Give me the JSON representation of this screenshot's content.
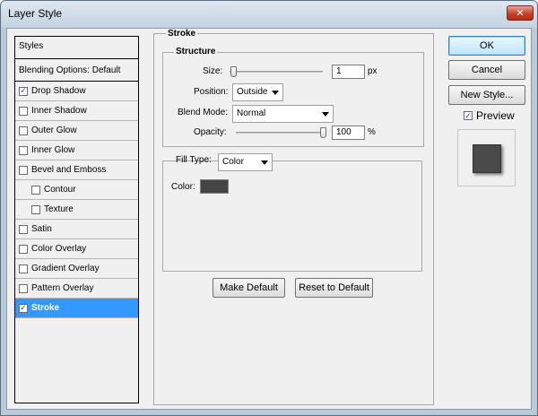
{
  "window": {
    "title": "Layer Style",
    "close_glyph": "✕"
  },
  "sidebar": {
    "header": "Styles",
    "items": [
      {
        "label": "Blending Options: Default",
        "checkbox": false,
        "checked": false,
        "indent": false,
        "selected": false,
        "kind": "blending"
      },
      {
        "label": "Drop Shadow",
        "checkbox": true,
        "checked": true,
        "indent": false,
        "selected": false
      },
      {
        "label": "Inner Shadow",
        "checkbox": true,
        "checked": false,
        "indent": false,
        "selected": false
      },
      {
        "label": "Outer Glow",
        "checkbox": true,
        "checked": false,
        "indent": false,
        "selected": false
      },
      {
        "label": "Inner Glow",
        "checkbox": true,
        "checked": false,
        "indent": false,
        "selected": false
      },
      {
        "label": "Bevel and Emboss",
        "checkbox": true,
        "checked": false,
        "indent": false,
        "selected": false
      },
      {
        "label": "Contour",
        "checkbox": true,
        "checked": false,
        "indent": true,
        "selected": false
      },
      {
        "label": "Texture",
        "checkbox": true,
        "checked": false,
        "indent": true,
        "selected": false
      },
      {
        "label": "Satin",
        "checkbox": true,
        "checked": false,
        "indent": false,
        "selected": false
      },
      {
        "label": "Color Overlay",
        "checkbox": true,
        "checked": false,
        "indent": false,
        "selected": false
      },
      {
        "label": "Gradient Overlay",
        "checkbox": true,
        "checked": false,
        "indent": false,
        "selected": false
      },
      {
        "label": "Pattern Overlay",
        "checkbox": true,
        "checked": false,
        "indent": false,
        "selected": false
      },
      {
        "label": "Stroke",
        "checkbox": true,
        "checked": true,
        "indent": false,
        "selected": true
      }
    ]
  },
  "stroke": {
    "group_title": "Stroke",
    "structure": {
      "title": "Structure",
      "size_label": "Size:",
      "size_value": "1",
      "size_unit": "px",
      "size_level": 0.0,
      "position_label": "Position:",
      "position_value": "Outside",
      "blend_mode_label": "Blend Mode:",
      "blend_mode_value": "Normal",
      "opacity_label": "Opacity:",
      "opacity_value": "100",
      "opacity_unit": "%",
      "opacity_level": 1.0
    },
    "fill": {
      "fill_type_label": "Fill Type:",
      "fill_type_value": "Color",
      "color_label": "Color:",
      "color_value": "#454545"
    },
    "make_default_label": "Make Default",
    "reset_default_label": "Reset to Default"
  },
  "actions": {
    "ok_label": "OK",
    "cancel_label": "Cancel",
    "new_style_label": "New Style...",
    "preview_label": "Preview",
    "preview_checked": true
  },
  "colors": {
    "selection": "#3399ff",
    "preview_fill": "#4a4a4a"
  }
}
